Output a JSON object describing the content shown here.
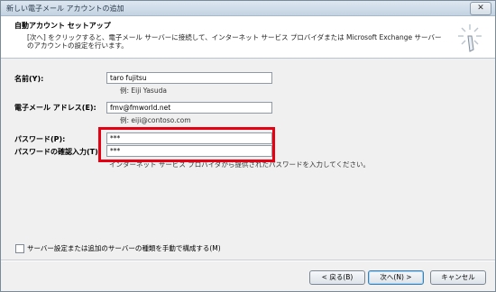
{
  "window": {
    "title": "新しい電子メール アカウントの追加",
    "close_label": "✕"
  },
  "header": {
    "title": "自動アカウント セットアップ",
    "description": "[次へ] をクリックすると、電子メール サーバーに接続して、インターネット サービス プロバイダまたは Microsoft Exchange サーバーのアカウントの設定を行います。"
  },
  "form": {
    "name": {
      "label": "名前(Y):",
      "value": "taro fujitsu",
      "example": "例: Eiji Yasuda"
    },
    "email": {
      "label": "電子メール アドレス(E):",
      "value": "fmv@fmworld.net",
      "example": "例: eiji@contoso.com"
    },
    "password": {
      "label": "パスワード(P):",
      "value": "***"
    },
    "password_confirm": {
      "label": "パスワードの確認入力(T):",
      "value": "***"
    },
    "password_hint": "インターネット サービス プロバイダから提供されたパスワードを入力してください。"
  },
  "manual_setup": {
    "label": "サーバー設定または追加のサーバーの種類を手動で構成する(M)",
    "checked": false
  },
  "buttons": {
    "back": "< 戻る(B)",
    "next": "次へ(N) >",
    "cancel": "キャンセル"
  },
  "colors": {
    "highlight": "#e60012",
    "header_bg": "#ffffff",
    "dialog_bg": "#f0f0f0"
  }
}
